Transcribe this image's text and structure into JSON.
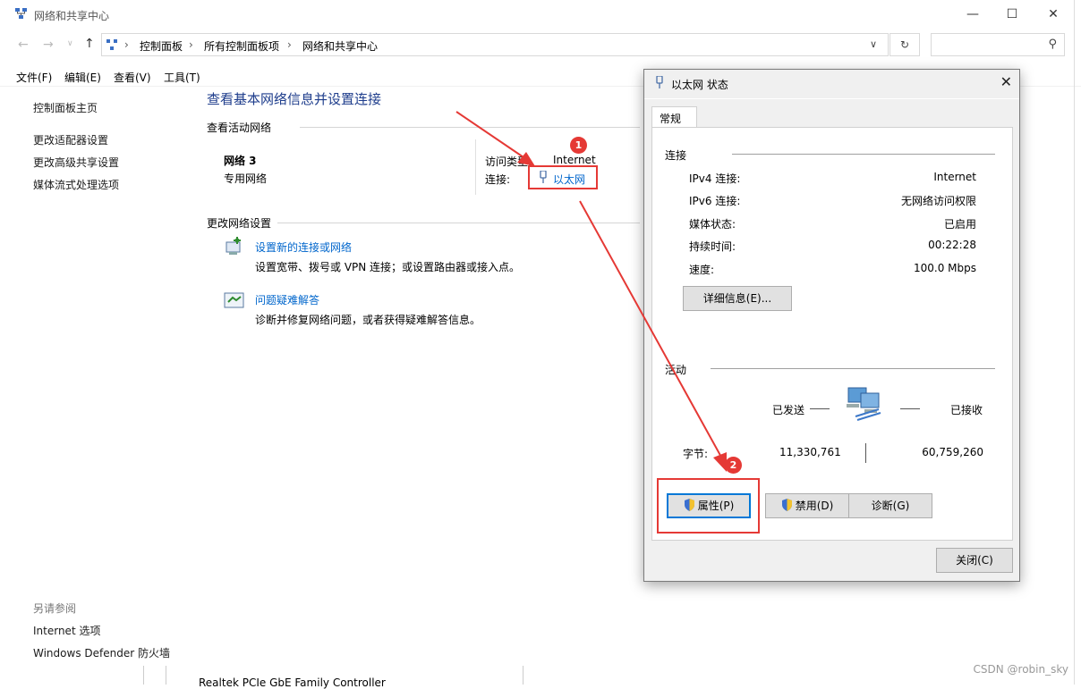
{
  "window": {
    "title": "网络和共享中心",
    "minimize": "—",
    "maximize": "☐",
    "close": "✕"
  },
  "nav": {
    "back": "←",
    "forward": "→",
    "dropdown": "∨",
    "up": "↑",
    "breadcrumb": [
      "控制面板",
      "所有控制面板项",
      "网络和共享中心"
    ],
    "separator": "›",
    "address_dropdown": "∨",
    "refresh": "↻",
    "search_placeholder": "",
    "search_icon": "⚲"
  },
  "menu": [
    "文件(F)",
    "编辑(E)",
    "查看(V)",
    "工具(T)"
  ],
  "sidebar": {
    "home": "控制面板主页",
    "links": [
      "更改适配器设置",
      "更改高级共享设置",
      "媒体流式处理选项"
    ],
    "see_also_title": "另请参阅",
    "see_also": [
      "Internet 选项",
      "Windows Defender 防火墙"
    ]
  },
  "content": {
    "heading": "查看基本网络信息并设置连接",
    "active_networks_title": "查看活动网络",
    "network_name": "网络 3",
    "network_type": "专用网络",
    "access_type_label": "访问类型:",
    "access_type_value": "Internet",
    "connection_label": "连接:",
    "connection_value": "以太网",
    "change_settings_title": "更改网络设置",
    "tasks": [
      {
        "link": "设置新的连接或网络",
        "desc": "设置宽带、拨号或 VPN 连接；或设置路由器或接入点。"
      },
      {
        "link": "问题疑难解答",
        "desc": "诊断并修复网络问题，或者获得疑难解答信息。"
      }
    ],
    "bottom_partial": "Realtek PCIe GbE Family Controller"
  },
  "dialog": {
    "title": "以太网 状态",
    "tab": "常规",
    "connection_group": "连接",
    "rows": [
      {
        "label": "IPv4 连接:",
        "value": "Internet"
      },
      {
        "label": "IPv6 连接:",
        "value": "无网络访问权限"
      },
      {
        "label": "媒体状态:",
        "value": "已启用"
      },
      {
        "label": "持续时间:",
        "value": "00:22:28"
      },
      {
        "label": "速度:",
        "value": "100.0 Mbps"
      }
    ],
    "details_button": "详细信息(E)...",
    "activity_group": "活动",
    "sent_label": "已发送",
    "received_label": "已接收",
    "bytes_label": "字节:",
    "bytes_sent": "11,330,761",
    "bytes_received": "60,759,260",
    "properties_button": "属性(P)",
    "disable_button": "禁用(D)",
    "diagnose_button": "诊断(G)",
    "close_button": "关闭(C)"
  },
  "annotations": {
    "badge1": "1",
    "badge2": "2",
    "color": "#e53935"
  },
  "watermark": "CSDN @robin_sky"
}
